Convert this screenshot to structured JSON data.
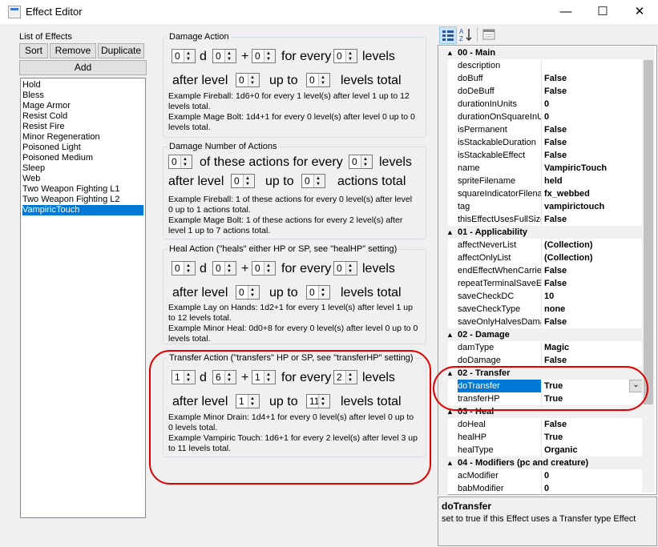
{
  "window": {
    "title": "Effect Editor",
    "min_glyph": "—",
    "max_glyph": "☐",
    "close_glyph": "✕"
  },
  "effects": {
    "label": "List of Effects",
    "sort_label": "Sort",
    "remove_label": "Remove",
    "duplicate_label": "Duplicate",
    "add_label": "Add",
    "items": [
      "Hold",
      "Bless",
      "Mage Armor",
      "Resist Cold",
      "Resist Fire",
      "Minor Regeneration",
      "Poisoned Light",
      "Poisoned Medium",
      "Sleep",
      "Web",
      "Two Weapon Fighting L1",
      "Two Weapon Fighting L2",
      "VampiricTouch"
    ],
    "selected": "VampiricTouch"
  },
  "damage_action": {
    "title": "Damage Action",
    "dice_count": "0",
    "d": "d",
    "dice_size": "0",
    "plus": "+",
    "bonus": "0",
    "for_every": "for every",
    "per_levels": "0",
    "levels": "levels",
    "after_level_label": "after level",
    "after_level": "0",
    "up_to": "up to",
    "up_to_level": "0",
    "levels_total": "levels total",
    "example1": "Example Fireball: 1d6+0 for every 1 level(s) after level 1 up to 12 levels total.",
    "example2": "Example Mage Bolt: 1d4+1 for every 0 level(s) after level 0 up to 0 levels total."
  },
  "damage_number": {
    "title": "Damage Number of Actions",
    "count": "0",
    "of_these": "of these actions for every",
    "per_levels": "0",
    "levels": "levels",
    "after_level_label": "after level",
    "after_level": "0",
    "up_to": "up to",
    "up_to_level": "0",
    "actions_total": "actions total",
    "example1": "Example Fireball: 1 of these actions for every 0 level(s) after level 0 up to 1 actions total.",
    "example2": "Example Mage Bolt: 1 of these actions for every 2 level(s) after level 1 up to 7 actions total."
  },
  "heal_action": {
    "title": "Heal Action (\"heals\" either HP or SP, see \"healHP\" setting)",
    "dice_count": "0",
    "d": "d",
    "dice_size": "0",
    "plus": "+",
    "bonus": "0",
    "for_every": "for every",
    "per_levels": "0",
    "levels": "levels",
    "after_level_label": "after level",
    "after_level": "0",
    "up_to": "up to",
    "up_to_level": "0",
    "levels_total": "levels total",
    "example1": "Example Lay on Hands: 1d2+1 for every 1 level(s) after level 1 up to 12 levels total.",
    "example2": "Example Minor Heal: 0d0+8 for every 0 level(s) after level 0 up to 0 levels total."
  },
  "transfer_action": {
    "title": "Transfer Action (\"transfers\" HP or SP, see \"transferHP\" setting)",
    "dice_count": "1",
    "d": "d",
    "dice_size": "6",
    "plus": "+",
    "bonus": "1",
    "for_every": "for every",
    "per_levels": "2",
    "levels": "levels",
    "after_level_label": "after level",
    "after_level": "1",
    "up_to": "up to",
    "up_to_level": "11",
    "levels_total": "levels total",
    "example1": "Example Minor Drain: 1d4+1 for every 0 level(s) after level 0 up to 0 levels total.",
    "example2": "Example Vampiric Touch: 1d6+1 for every 2 level(s) after level 3 up to 11 levels total."
  },
  "property_grid": {
    "toolbar": {
      "categorized_icon": "categorized-icon",
      "alphabetical_icon": "alphabetical-sort-icon",
      "pages_icon": "property-pages-icon"
    },
    "rows": [
      {
        "cat": "00 - Main"
      },
      {
        "name": "description",
        "value": ""
      },
      {
        "name": "doBuff",
        "value": "False"
      },
      {
        "name": "doDeBuff",
        "value": "False"
      },
      {
        "name": "durationInUnits",
        "value": "0"
      },
      {
        "name": "durationOnSquareInU",
        "value": "0"
      },
      {
        "name": "isPermanent",
        "value": "False"
      },
      {
        "name": "isStackableDuration",
        "value": "False"
      },
      {
        "name": "isStackableEffect",
        "value": "False"
      },
      {
        "name": "name",
        "value": "VampiricTouch"
      },
      {
        "name": "spriteFilename",
        "value": "held"
      },
      {
        "name": "squareIndicatorFilena",
        "value": "fx_webbed"
      },
      {
        "name": "tag",
        "value": "vampirictouch"
      },
      {
        "name": "thisEffectUsesFullSize",
        "value": "False"
      },
      {
        "cat": "01 - Applicability"
      },
      {
        "name": "affectNeverList",
        "value": "(Collection)"
      },
      {
        "name": "affectOnlyList",
        "value": "(Collection)"
      },
      {
        "name": "endEffectWhenCarrie",
        "value": "False"
      },
      {
        "name": "repeatTerminalSaveE",
        "value": "False"
      },
      {
        "name": "saveCheckDC",
        "value": "10"
      },
      {
        "name": "saveCheckType",
        "value": "none"
      },
      {
        "name": "saveOnlyHalvesDama",
        "value": "False"
      },
      {
        "cat": "02 - Damage"
      },
      {
        "name": "damType",
        "value": "Magic"
      },
      {
        "name": "doDamage",
        "value": "False"
      },
      {
        "cat": "02 - Transfer"
      },
      {
        "name": "doTransfer",
        "value": "True",
        "selected": true
      },
      {
        "name": "transferHP",
        "value": "True"
      },
      {
        "cat": "03 - Heal"
      },
      {
        "name": "doHeal",
        "value": "False"
      },
      {
        "name": "healHP",
        "value": "True"
      },
      {
        "name": "healType",
        "value": "Organic"
      },
      {
        "cat": "04 - Modifiers (pc and creature)"
      },
      {
        "name": "acModifier",
        "value": "0"
      },
      {
        "name": "babModifier",
        "value": "0"
      }
    ],
    "collapse_glyph": "▲",
    "dropdown_glyph": "⌄"
  },
  "description_panel": {
    "title": "doTransfer",
    "text": "set to true if this Effect uses a Transfer type Effect"
  },
  "colors": {
    "selection": "#0078d7",
    "annotation": "#e00000"
  }
}
